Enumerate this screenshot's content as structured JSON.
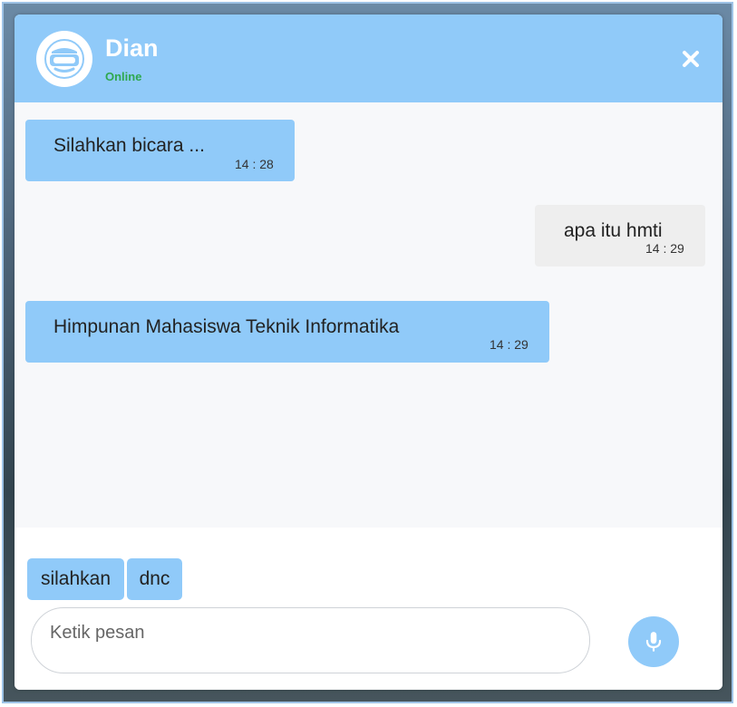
{
  "header": {
    "contact_name": "Dian",
    "status": "Online",
    "avatar_icon": "vr-headset-icon",
    "close_icon": "close-icon"
  },
  "messages": [
    {
      "direction": "incoming",
      "text": "Silahkan bicara ...",
      "time": "14 : 28"
    },
    {
      "direction": "outgoing",
      "text": "apa itu hmti",
      "time": "14 : 29"
    },
    {
      "direction": "incoming",
      "text": "Himpunan Mahasiswa Teknik Informatika",
      "time": "14 : 29"
    }
  ],
  "quick_replies": [
    {
      "label": "silahkan"
    },
    {
      "label": "dnc"
    }
  ],
  "input": {
    "placeholder": "Ketik pesan",
    "value": ""
  },
  "mic_icon": "microphone-icon",
  "colors": {
    "accent": "#90caf9",
    "online": "#2fa84f",
    "outgoing_bubble": "#eeeeee",
    "message_area": "#f7f8fa"
  }
}
